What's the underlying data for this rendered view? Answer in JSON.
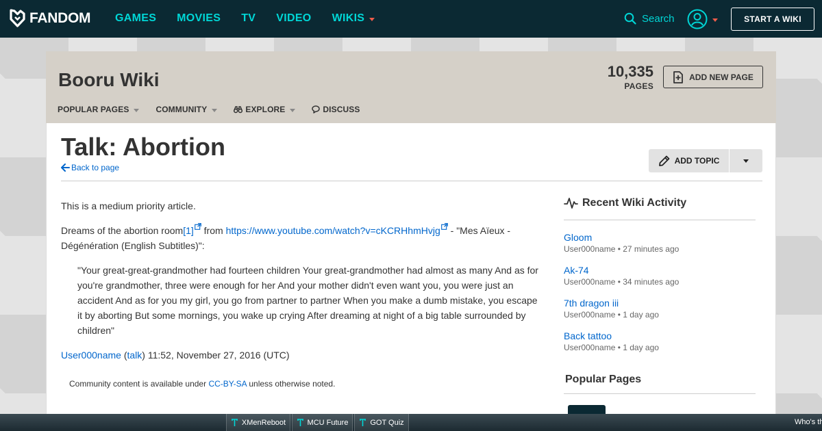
{
  "topnav": {
    "logo_text": "FANDOM",
    "links": [
      "GAMES",
      "MOVIES",
      "TV",
      "VIDEO",
      "WIKIS"
    ],
    "search_label": "Search",
    "start_wiki_label": "START A WIKI"
  },
  "wiki": {
    "name": "Booru Wiki",
    "page_count": "10,335",
    "page_count_label": "PAGES",
    "add_page_label": "ADD NEW PAGE",
    "tabs": [
      "POPULAR PAGES",
      "COMMUNITY",
      "EXPLORE",
      "DISCUSS"
    ]
  },
  "page": {
    "title": "Talk: Abortion",
    "back_label": "Back to page",
    "add_topic_label": "ADD TOPIC"
  },
  "article": {
    "p1": "This is a medium priority article.",
    "p2_start": "Dreams of the abortion room",
    "p2_ref": "[1]",
    "p2_from": " from ",
    "p2_url": "https://www.youtube.com/watch?v=cKCRHhmHvjg",
    "p2_end": " - \"Mes Aïeux - Dégénération (English Subtitles)\":",
    "quote": "\"Your great-great-grandmother had fourteen children Your great-grandmother had almost as many And as for you're grandmother, three were enough for her And your mother didn't even want you, you were just an accident And as for you my girl, you go from partner to partner When you make a dumb mistake, you escape it by aborting But some mornings, you wake up crying After dreaming at night of a big table surrounded by children\"",
    "sig_user": "User000name",
    "sig_open": " (",
    "sig_talk": "talk",
    "sig_close": ") 11:52, November 27, 2016 (UTC)"
  },
  "license": {
    "prefix": "Community content is available under ",
    "link": "CC-BY-SA",
    "suffix": " unless otherwise noted."
  },
  "rail": {
    "activity_title": "Recent Wiki Activity",
    "activity": [
      {
        "title": "Gloom",
        "meta": "User000name • 27 minutes ago"
      },
      {
        "title": "Ak-74",
        "meta": "User000name • 34 minutes ago"
      },
      {
        "title": "7th dragon iii",
        "meta": "User000name • 1 day ago"
      },
      {
        "title": "Back tattoo",
        "meta": "User000name • 1 day ago"
      }
    ],
    "popular_title": "Popular Pages"
  },
  "bottom_bar": {
    "trending": [
      "XMenReboot",
      "MCU Future",
      "GOT Quiz"
    ],
    "ticker": "Who's th"
  },
  "colors": {
    "nav_bg": "#0b2933",
    "nav_link": "#00d6d6",
    "accent_red": "#ee5c4a",
    "header_bg": "#d5d0c8",
    "link": "#0066cc"
  }
}
